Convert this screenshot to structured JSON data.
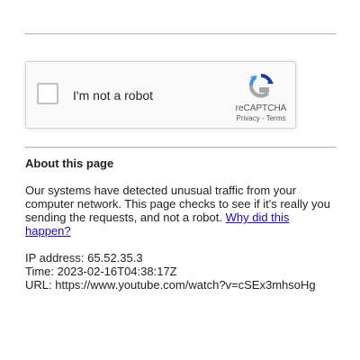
{
  "recaptcha": {
    "checkbox_label": "I'm not a robot",
    "brand": "reCAPTCHA",
    "privacy_link": "Privacy",
    "separator": " - ",
    "terms_link": "Terms"
  },
  "about": {
    "heading": "About this page",
    "body": "Our systems have detected unusual traffic from your computer network. This page checks to see if it's really you sending the requests, and not a robot. ",
    "why_link": "Why did this happen?"
  },
  "details": {
    "ip_label": "IP address: ",
    "ip_value": "65.52.35.3",
    "time_label": "Time: ",
    "time_value": "2023-02-16T04:38:17Z",
    "url_label": "URL: ",
    "url_value": "https://www.youtube.com/watch?v=cSEx3mhsoHg"
  },
  "colors": {
    "link": "#1a0dab",
    "recaptcha_blue": "#4a90e2",
    "recaptcha_gray": "#a6a6a6",
    "recaptcha_dark_blue": "#1c3aa9"
  },
  "icons": {
    "recaptcha_logo": "recaptcha-logo-icon"
  }
}
